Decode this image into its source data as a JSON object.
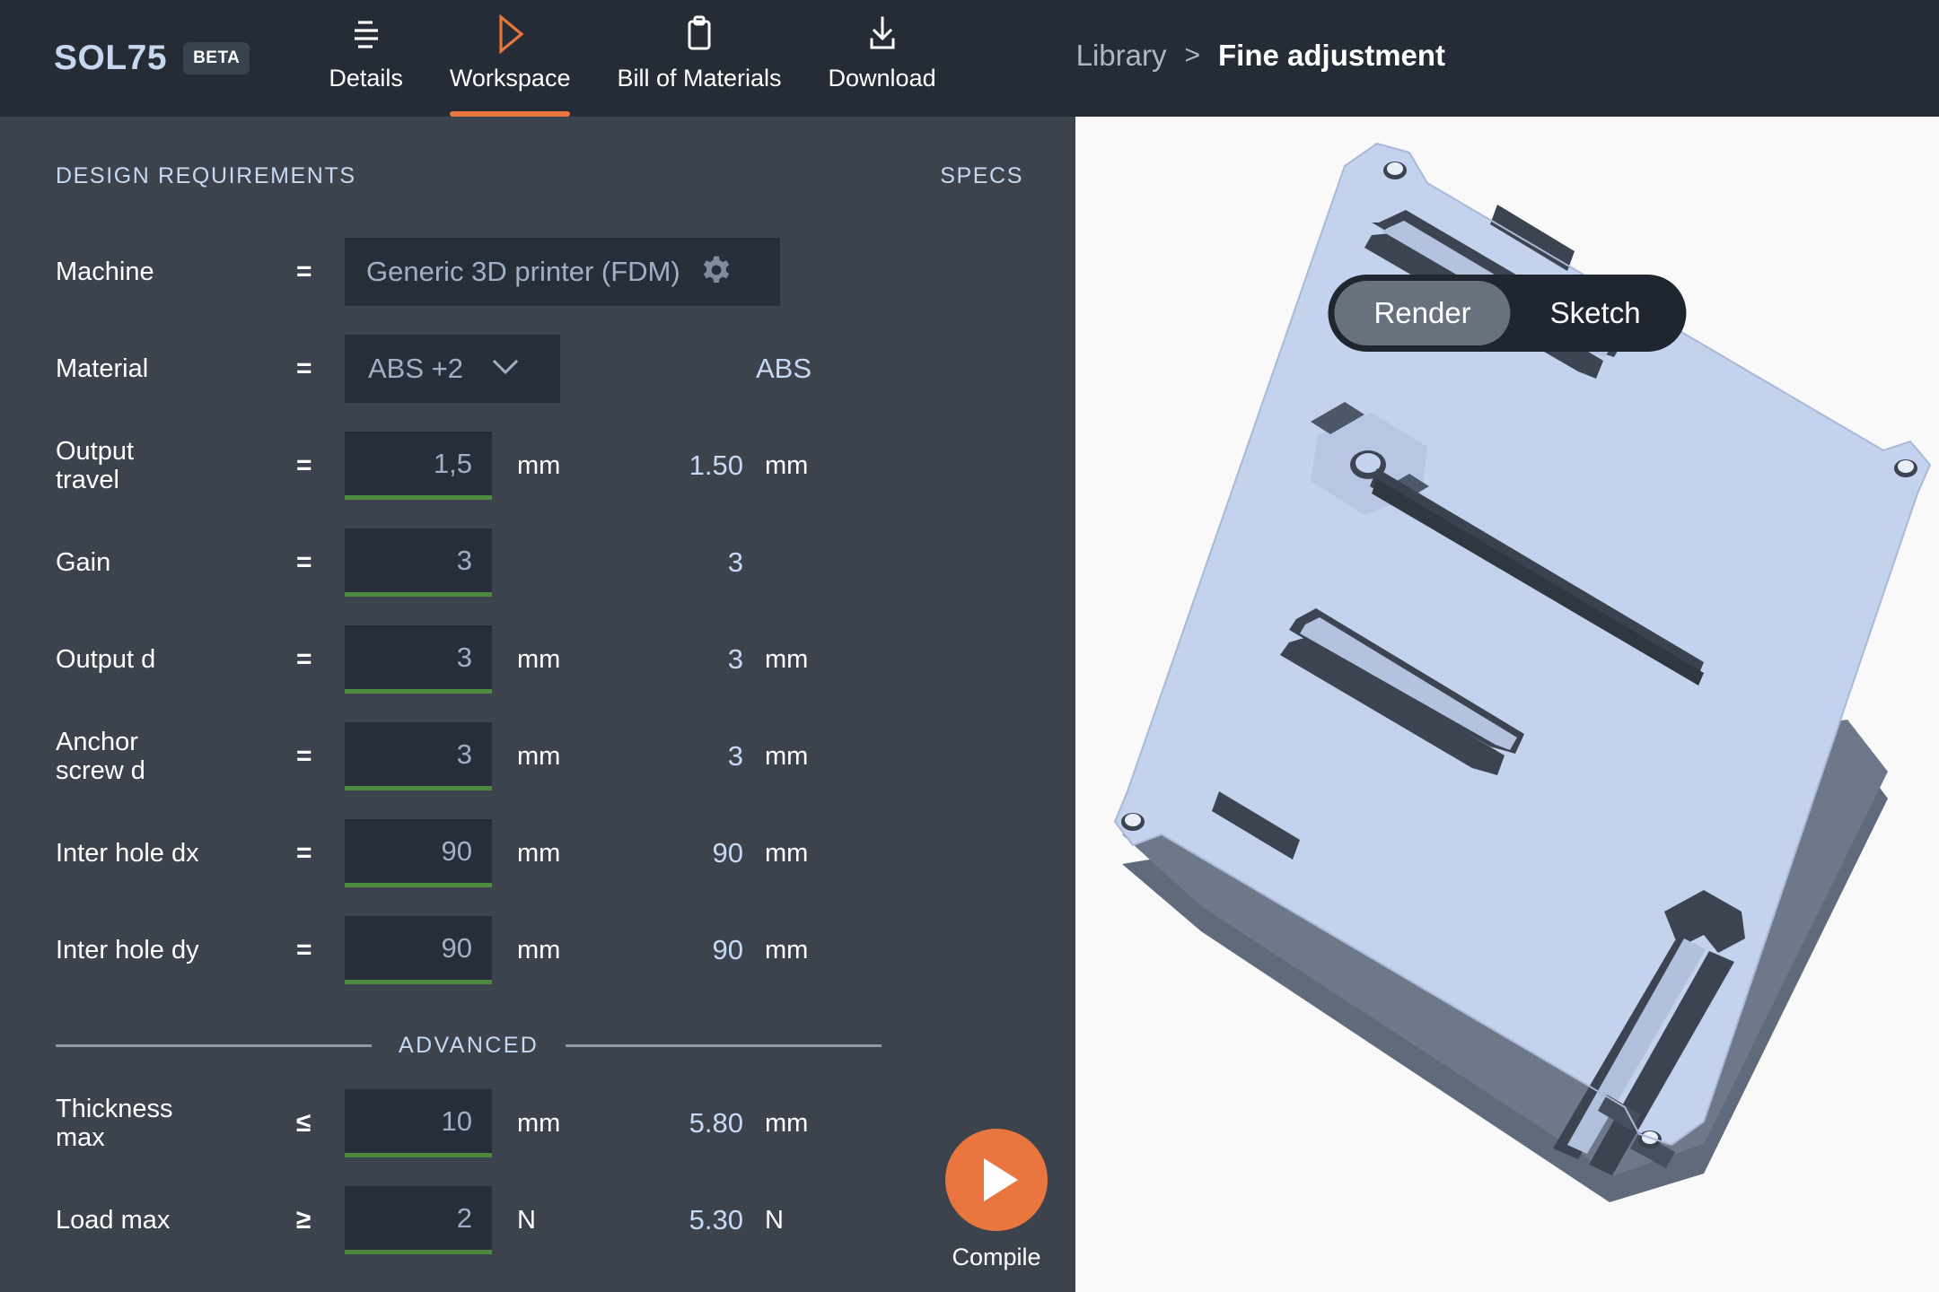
{
  "brand": {
    "name": "SOL75",
    "badge": "BETA"
  },
  "nav": {
    "items": [
      {
        "label": "Details",
        "icon": "list-icon",
        "active": false
      },
      {
        "label": "Workspace",
        "icon": "play-triangle-icon",
        "active": true
      },
      {
        "label": "Bill of Materials",
        "icon": "clipboard-icon",
        "active": false
      },
      {
        "label": "Download",
        "icon": "download-icon",
        "active": false
      }
    ],
    "active_accent": "#e8763e"
  },
  "breadcrumb": {
    "parent": "Library",
    "separator": ">",
    "current": "Fine adjustment"
  },
  "panel": {
    "heading_requirements": "DESIGN REQUIREMENTS",
    "heading_specs": "SPECS",
    "advanced_divider": "ADVANCED"
  },
  "rows": {
    "machine": {
      "label": "Machine",
      "op": "=",
      "value": "Generic 3D printer (FDM)",
      "gear": "gear-icon"
    },
    "material": {
      "label": "Material",
      "op": "=",
      "value": "ABS  +2",
      "chevron": "chevron-down-icon",
      "spec": "ABS"
    },
    "output_travel": {
      "label": "Output\ntravel",
      "op": "=",
      "value": "1,5",
      "unit": "mm",
      "spec": "1.50",
      "spec_unit": "mm"
    },
    "gain": {
      "label": "Gain",
      "op": "=",
      "value": "3",
      "unit": "",
      "spec": "3",
      "spec_unit": ""
    },
    "output_d": {
      "label": "Output d",
      "op": "=",
      "value": "3",
      "unit": "mm",
      "spec": "3",
      "spec_unit": "mm"
    },
    "anchor_screw_d": {
      "label": "Anchor\nscrew d",
      "op": "=",
      "value": "3",
      "unit": "mm",
      "spec": "3",
      "spec_unit": "mm"
    },
    "inter_hole_dx": {
      "label": "Inter hole dx",
      "op": "=",
      "value": "90",
      "unit": "mm",
      "spec": "90",
      "spec_unit": "mm"
    },
    "inter_hole_dy": {
      "label": "Inter hole dy",
      "op": "=",
      "value": "90",
      "unit": "mm",
      "spec": "90",
      "spec_unit": "mm"
    },
    "thickness_max": {
      "label": "Thickness\nmax",
      "op": "≤",
      "value": "10",
      "unit": "mm",
      "spec": "5.80",
      "spec_unit": "mm"
    },
    "load_max": {
      "label": "Load max",
      "op": "≥",
      "value": "2",
      "unit": "N",
      "spec": "5.30",
      "spec_unit": "N"
    }
  },
  "compile": {
    "label": "Compile",
    "icon": "play-icon"
  },
  "viewer": {
    "toggle": {
      "options": [
        "Render",
        "Sketch"
      ],
      "selected": "Render"
    },
    "model": "flexure-stage-plate"
  },
  "colors": {
    "topbar_bg": "#252c35",
    "left_panel_bg": "#3c434d",
    "right_panel_bg": "#f9f9f9",
    "field_bg": "#262e39",
    "field_underline": "#4b8a3c",
    "accent_orange": "#e8763e",
    "spec_text": "#c6daf5",
    "model_face": "#c3d3ee",
    "model_edge": "#5a6676"
  }
}
